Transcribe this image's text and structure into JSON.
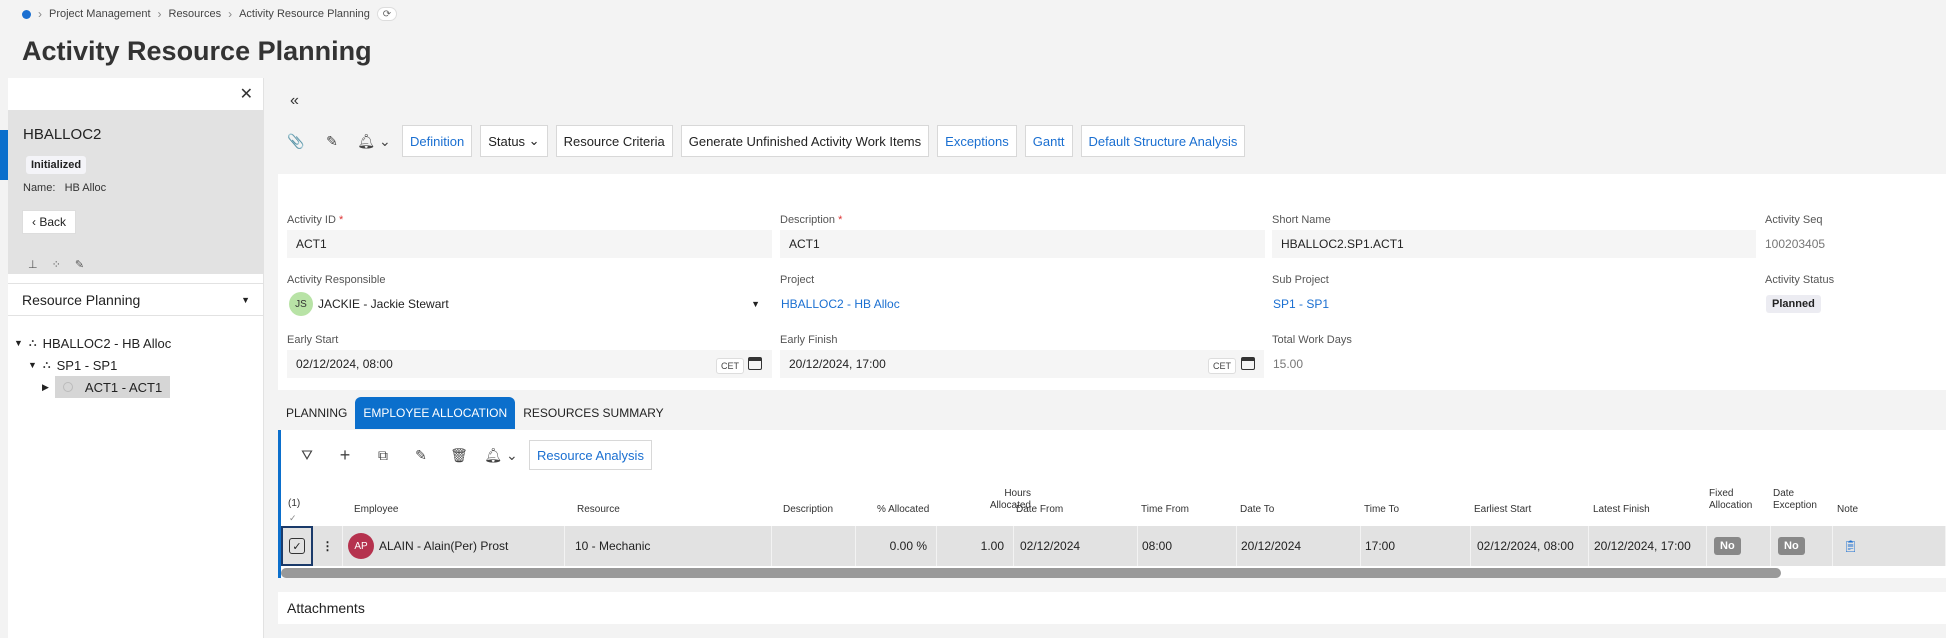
{
  "breadcrumb": [
    "Project Management",
    "Resources",
    "Activity Resource Planning"
  ],
  "page_title": "Activity Resource Planning",
  "left": {
    "record_code": "HBALLOC2",
    "status_badge": "Initialized",
    "name_label": "Name:",
    "name_value": "HB Alloc",
    "back_label": "Back",
    "selector": "Resource Planning",
    "tree": [
      "HBALLOC2 - HB Alloc",
      "SP1 - SP1",
      "ACT1 - ACT1"
    ]
  },
  "toolbar": [
    "Definition",
    "Status",
    "Resource Criteria",
    "Generate Unfinished Activity Work Items",
    "Exceptions",
    "Gantt",
    "Default Structure Analysis"
  ],
  "form": {
    "activity_id_label": "Activity ID",
    "activity_id": "ACT1",
    "description_label": "Description",
    "description": "ACT1",
    "short_name_label": "Short Name",
    "short_name": "HBALLOC2.SP1.ACT1",
    "activity_seq_label": "Activity Seq",
    "activity_seq": "100203405",
    "responsible_label": "Activity Responsible",
    "responsible_initials": "JS",
    "responsible": "JACKIE - Jackie Stewart",
    "project_label": "Project",
    "project": "HBALLOC2 - HB Alloc",
    "sub_project_label": "Sub Project",
    "sub_project": "SP1 - SP1",
    "status_label": "Activity Status",
    "status": "Planned",
    "early_start_label": "Early Start",
    "early_start": "02/12/2024, 08:00",
    "early_finish_label": "Early Finish",
    "early_finish": "20/12/2024, 17:00",
    "tz": "CET",
    "total_work_days_label": "Total Work Days",
    "total_work_days": "15.00"
  },
  "tabs": [
    "PLANNING",
    "EMPLOYEE ALLOCATION",
    "RESOURCES SUMMARY"
  ],
  "grid": {
    "resource_analysis": "Resource Analysis",
    "selection_count": "(1)",
    "headers": {
      "employee": "Employee",
      "resource": "Resource",
      "description": "Description",
      "allocated": "% Allocated",
      "hours_a": "Hours",
      "hours_b": "Allocated",
      "date_from": "Date From",
      "time_from": "Time From",
      "date_to": "Date To",
      "time_to": "Time To",
      "earliest_start": "Earliest Start",
      "latest_finish": "Latest Finish",
      "fixed_a": "Fixed",
      "fixed_b": "Allocation",
      "exc_a": "Date",
      "exc_b": "Exception",
      "note": "Note"
    },
    "row": {
      "initials": "AP",
      "employee": "ALAIN - Alain(Per) Prost",
      "resource": "10 - Mechanic",
      "description": "",
      "allocated": "0.00 %",
      "hours": "1.00",
      "date_from": "02/12/2024",
      "time_from": "08:00",
      "date_to": "20/12/2024",
      "time_to": "17:00",
      "earliest_start": "02/12/2024, 08:00",
      "latest_finish": "20/12/2024, 17:00",
      "fixed": "No",
      "exception": "No"
    }
  },
  "attachments": "Attachments",
  "colors": {
    "accent": "#0b6fcc",
    "link": "#1a6fd1",
    "avatar_js": "#b8e3a6",
    "avatar_ap": "#b5324e"
  }
}
